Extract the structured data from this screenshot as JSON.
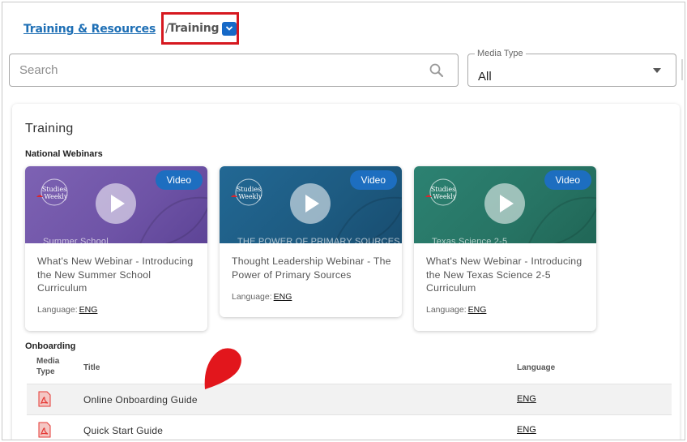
{
  "breadcrumb": {
    "parent_label": "Training & Resources",
    "separator": "/",
    "current_label": "Training"
  },
  "search": {
    "placeholder": "Search",
    "value": ""
  },
  "media_type": {
    "label": "Media Type",
    "value": "All"
  },
  "panel": {
    "title": "Training",
    "webinars_heading": "National Webinars",
    "onboarding_heading": "Onboarding"
  },
  "webinars": [
    {
      "badge": "Video",
      "image_caption": "Summer School",
      "title": "What's New Webinar - Introducing the New Summer School Curriculum",
      "language_label": "Language:",
      "language": "ENG",
      "color": "#7b5fb0"
    },
    {
      "badge": "Video",
      "image_caption": "THE POWER OF PRIMARY SOURCES",
      "title": "Thought Leadership Webinar - The Power of Primary Sources",
      "language_label": "Language:",
      "language": "ENG",
      "color": "#1f5f86"
    },
    {
      "badge": "Video",
      "image_caption": "Texas Science 2-5",
      "title": "What's New Webinar - Introducing the New Texas Science 2-5 Curriculum",
      "language_label": "Language:",
      "language": "ENG",
      "color": "#2a7b6c"
    }
  ],
  "onboarding_table": {
    "headers": {
      "media_type": "Media Type",
      "title": "Title",
      "language": "Language"
    },
    "rows": [
      {
        "icon": "pdf-icon",
        "title": "Online Onboarding Guide",
        "language": "ENG"
      },
      {
        "icon": "pdf-icon",
        "title": "Quick Start Guide",
        "language": "ENG"
      }
    ]
  },
  "colors": {
    "accent": "#1d6ec0",
    "highlight_box": "#d6181f",
    "pin": "#e2161c",
    "pdf": "#e53935"
  }
}
